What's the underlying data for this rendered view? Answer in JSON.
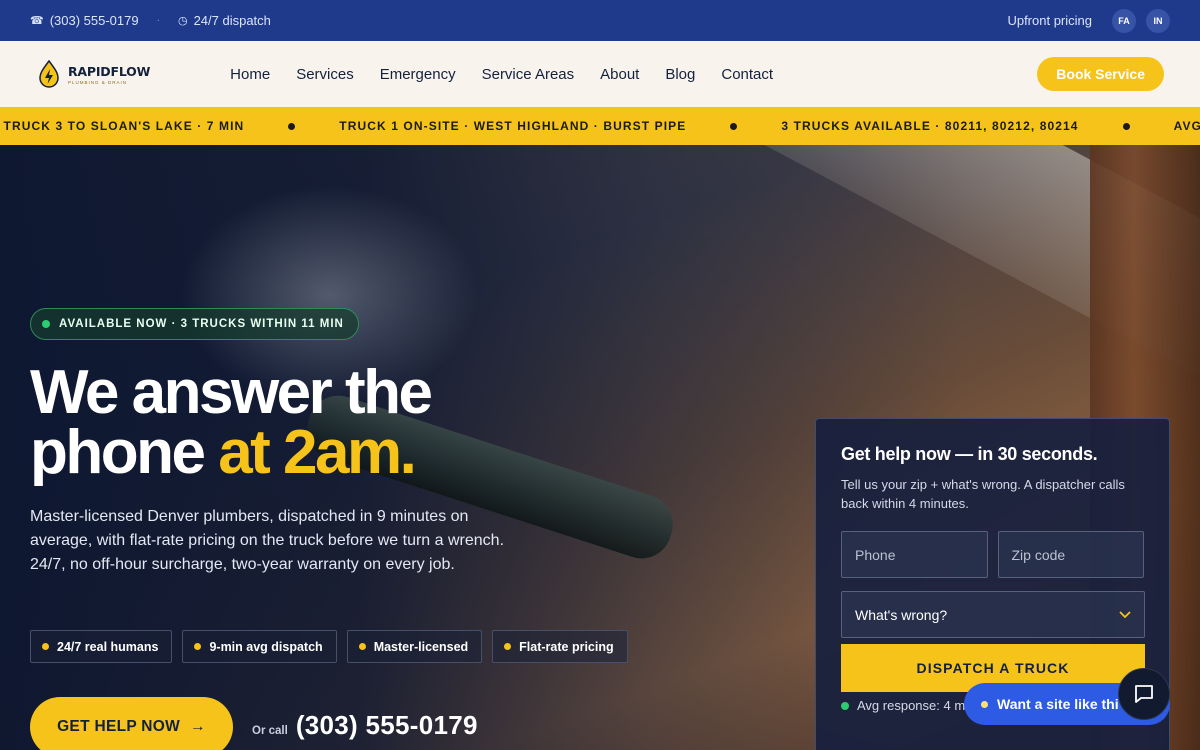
{
  "topbar": {
    "phone": "(303) 555-0179",
    "dispatch": "24/7 dispatch",
    "upfront": "Upfront pricing",
    "languages": [
      "FA",
      "IN"
    ]
  },
  "brand": {
    "name": "RAPIDFLOW",
    "tagline": "PLUMBING & DRAIN"
  },
  "nav": {
    "items": [
      "Home",
      "Services",
      "Emergency",
      "Service Areas",
      "About",
      "Blog",
      "Contact"
    ],
    "book_label": "Book Service"
  },
  "ticker": {
    "items": [
      "· TRUCK 3 TO SLOAN'S LAKE · 7 MIN",
      "TRUCK 1 ON-SITE · WEST HIGHLAND · BURST PIPE",
      "3 TRUCKS AVAILABLE · 80211, 80212, 80214",
      "AVG"
    ]
  },
  "hero": {
    "badge": "AVAILABLE NOW · 3 TRUCKS WITHIN 11 MIN",
    "headline_line1": "We answer the",
    "headline_line2_prefix": "phone ",
    "headline_accent": "at 2am.",
    "lede": "Master-licensed Denver plumbers, dispatched in 9 minutes on average, with flat-rate pricing on the truck before we turn a wrench. 24/7, no off-hour surcharge, two-year warranty on every job.",
    "chips": [
      "24/7 real humans",
      "9-min avg dispatch",
      "Master-licensed",
      "Flat-rate pricing"
    ],
    "cta_label": "GET HELP NOW",
    "cta_arrow": "→",
    "or_call": "Or call",
    "phone": "(303) 555-0179"
  },
  "form": {
    "title": "Get help now — in 30 seconds.",
    "subtitle": "Tell us your zip + what's wrong. A dispatcher calls back within 4 minutes.",
    "phone_placeholder": "Phone",
    "zip_placeholder": "Zip code",
    "issue_select": "What's wrong?",
    "submit_label": "DISPATCH A TRUCK",
    "avg_response": "Avg response: 4 m"
  },
  "widgets": {
    "want_site": "Want a site like thi"
  },
  "colors": {
    "accent": "#f6c31a",
    "topbar": "#1f3a8a",
    "navy": "#14213d",
    "status_green": "#2ecc71",
    "widget_blue": "#2d5be3"
  },
  "icons": [
    "phone-icon",
    "clock-icon",
    "bolt-logo-icon",
    "arrow-right-icon",
    "chevron-down-icon",
    "chat-icon"
  ]
}
